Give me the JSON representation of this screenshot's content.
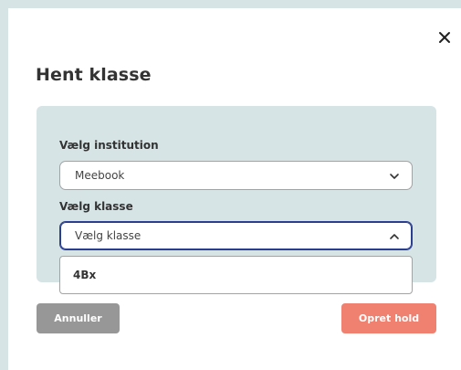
{
  "modal": {
    "title": "Hent klasse",
    "close_icon": "close-icon"
  },
  "form": {
    "institution": {
      "label": "Vælg institution",
      "value": "Meebook",
      "icon": "chevron-down-icon"
    },
    "klasse": {
      "label": "Vælg klasse",
      "placeholder": "Vælg klasse",
      "icon": "chevron-up-icon",
      "options": [
        "4Bx"
      ]
    }
  },
  "footer": {
    "cancel_label": "Annuller",
    "create_label": "Opret hold"
  },
  "colors": {
    "panel": "#d6e4e6",
    "focus_border": "#2b3e8f",
    "cancel": "#979797",
    "create": "#f08070"
  }
}
